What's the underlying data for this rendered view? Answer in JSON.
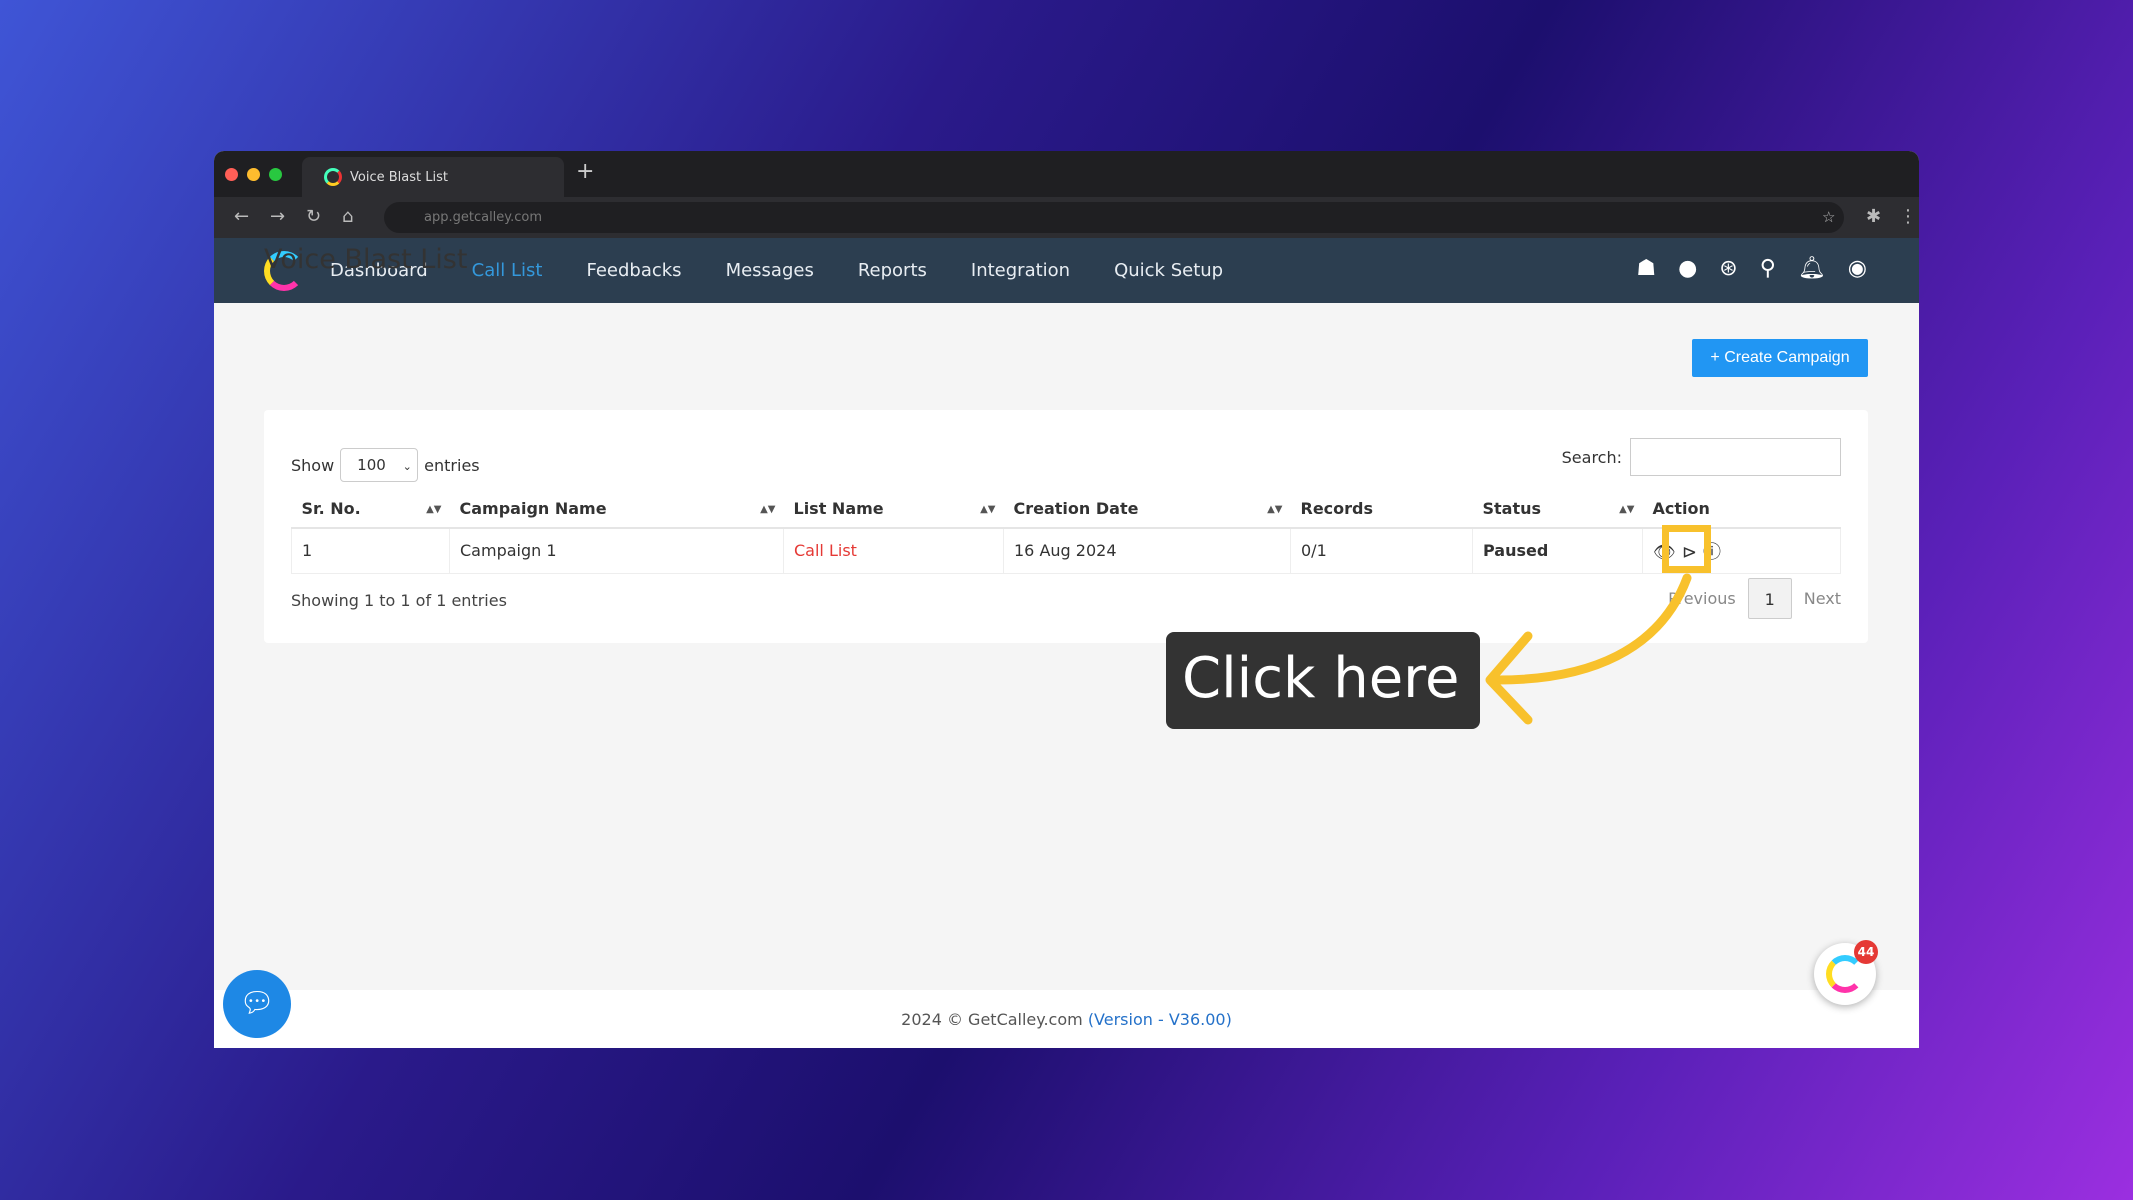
{
  "browser": {
    "tab_title": "Voice Blast List",
    "url": "app.getcalley.com"
  },
  "nav": {
    "items": [
      "Dashboard",
      "Call List",
      "Feedbacks",
      "Messages",
      "Reports",
      "Integration",
      "Quick Setup"
    ],
    "active": "Call List",
    "icons": [
      "android-icon",
      "apple-icon",
      "support-icon",
      "search-icon",
      "bell-icon",
      "user-icon"
    ]
  },
  "page": {
    "title": "Voice Blast List",
    "create_label": "+ Create Campaign"
  },
  "table": {
    "show_label": "Show",
    "entries_value": "100",
    "entries_label": "entries",
    "search_label": "Search:",
    "headers": [
      "Sr. No.",
      "Campaign Name",
      "List Name",
      "Creation Date",
      "Records",
      "Status",
      "Action"
    ],
    "rows": [
      [
        "1",
        "Campaign 1",
        "Call List",
        "16 Aug 2024",
        "0/1",
        "Paused"
      ]
    ],
    "info": "Showing 1 to 1 of 1 entries",
    "prev": "Previous",
    "page": "1",
    "next": "Next"
  },
  "annotation": {
    "text": "Click here",
    "color": "#f8c12c"
  },
  "footer": {
    "text": "2024 © GetCalley.com ",
    "version": "(Version - V36.00)"
  },
  "widget": {
    "badge": "44"
  },
  "colors": {
    "accent": "#2196f3",
    "nav_bg": "#2c3e50",
    "link_red": "#e53935"
  }
}
